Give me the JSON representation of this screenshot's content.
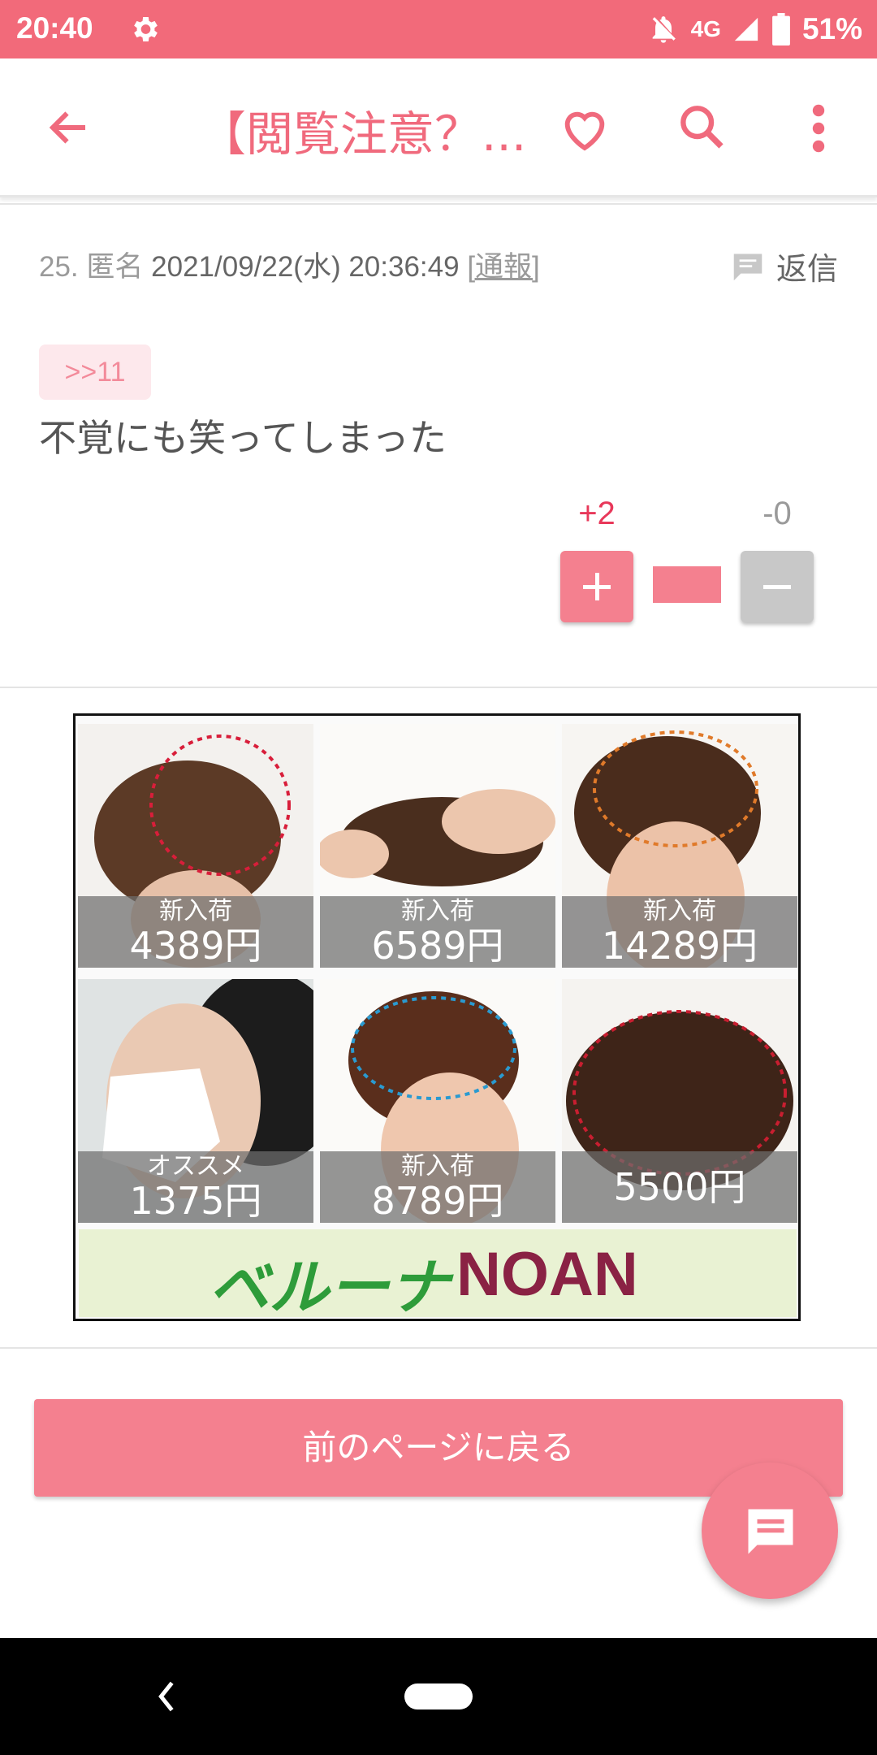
{
  "status_bar": {
    "time": "20:40",
    "network": "4G",
    "battery": "51%"
  },
  "app_bar": {
    "title": "【閲覧注意？..."
  },
  "post": {
    "number": "25.",
    "author": "匿名",
    "timestamp": "2021/09/22(水) 20:36:49",
    "report_label": "[通報]",
    "reply_label": "返信",
    "anchor": ">>11",
    "body": "不覚にも笑ってしまった",
    "plus_count": "+2",
    "minus_count": "-0",
    "vote_ratio": 1.0
  },
  "ad": {
    "tiles": [
      {
        "tag": "新入荷",
        "price": "4389円"
      },
      {
        "tag": "新入荷",
        "price": "6589円"
      },
      {
        "tag": "新入荷",
        "price": "14289円"
      },
      {
        "tag": "オススメ",
        "price": "1375円"
      },
      {
        "tag": "新入荷",
        "price": "8789円"
      },
      {
        "tag": "",
        "price": "5500円"
      }
    ],
    "banner_brand_1": "ベルーナ",
    "banner_brand_2": "NOAN"
  },
  "back_button_label": "前のページに戻る",
  "colors": {
    "accent": "#f26a7a",
    "button": "#f4808f",
    "plus": "#e8385a"
  }
}
